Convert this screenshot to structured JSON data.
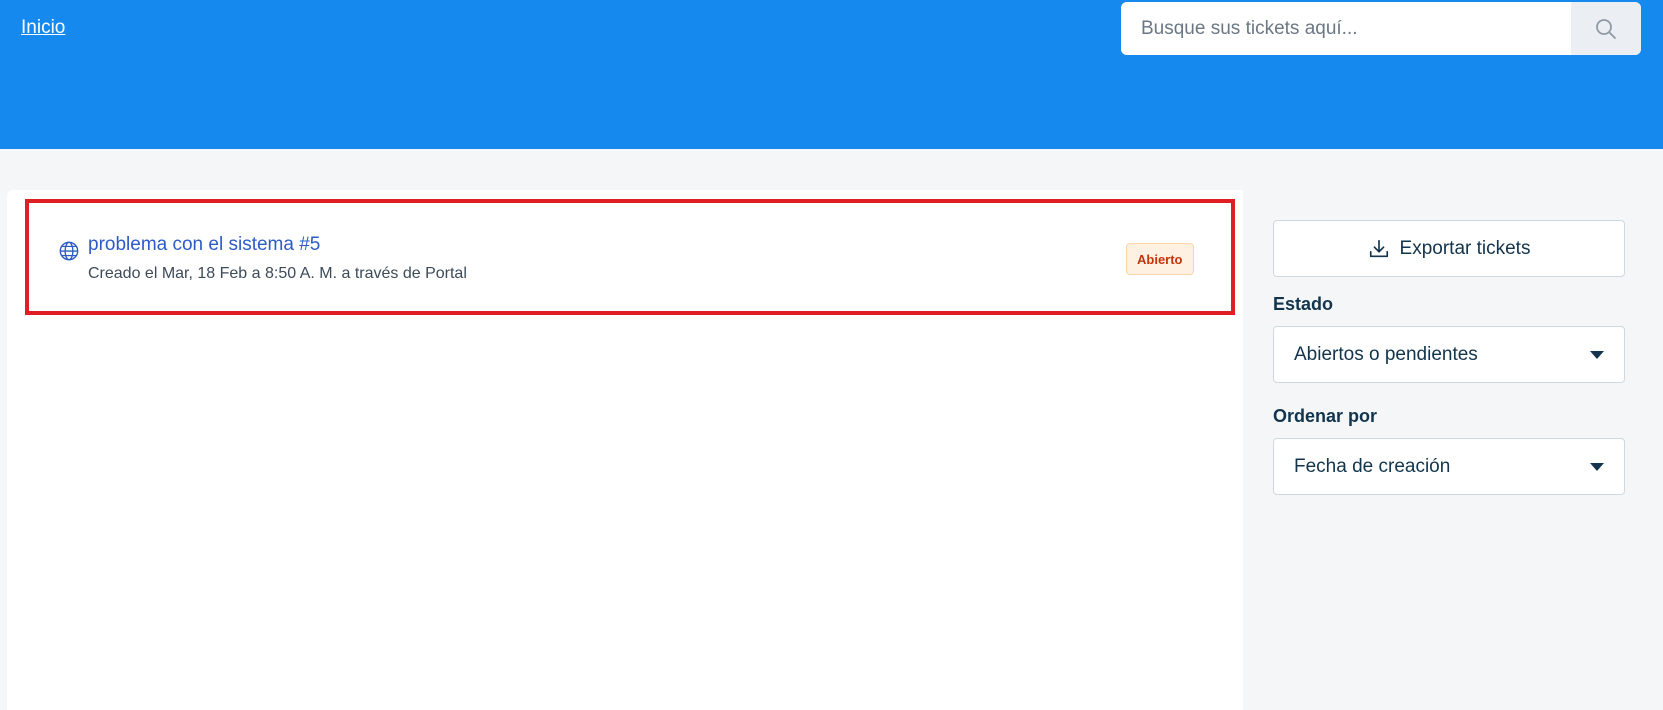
{
  "header": {
    "home_label": "Inicio",
    "background_color": "#1589ee",
    "search": {
      "placeholder": "Busque sus tickets aquí...",
      "value": "",
      "icon": "search-icon"
    }
  },
  "tickets": [
    {
      "title": "problema con el sistema #5",
      "meta": "Creado el Mar, 18 Feb a 8:50 A. M. a través de Portal",
      "status": "Abierto",
      "source_icon": "globe-icon",
      "highlight_color": "#e01f25"
    }
  ],
  "sidebar": {
    "export_label": "Exportar tickets",
    "export_icon": "download-icon",
    "status_filter": {
      "label": "Estado",
      "selected": "Abiertos o pendientes"
    },
    "sort_filter": {
      "label": "Ordenar por",
      "selected": "Fecha de creación"
    }
  }
}
